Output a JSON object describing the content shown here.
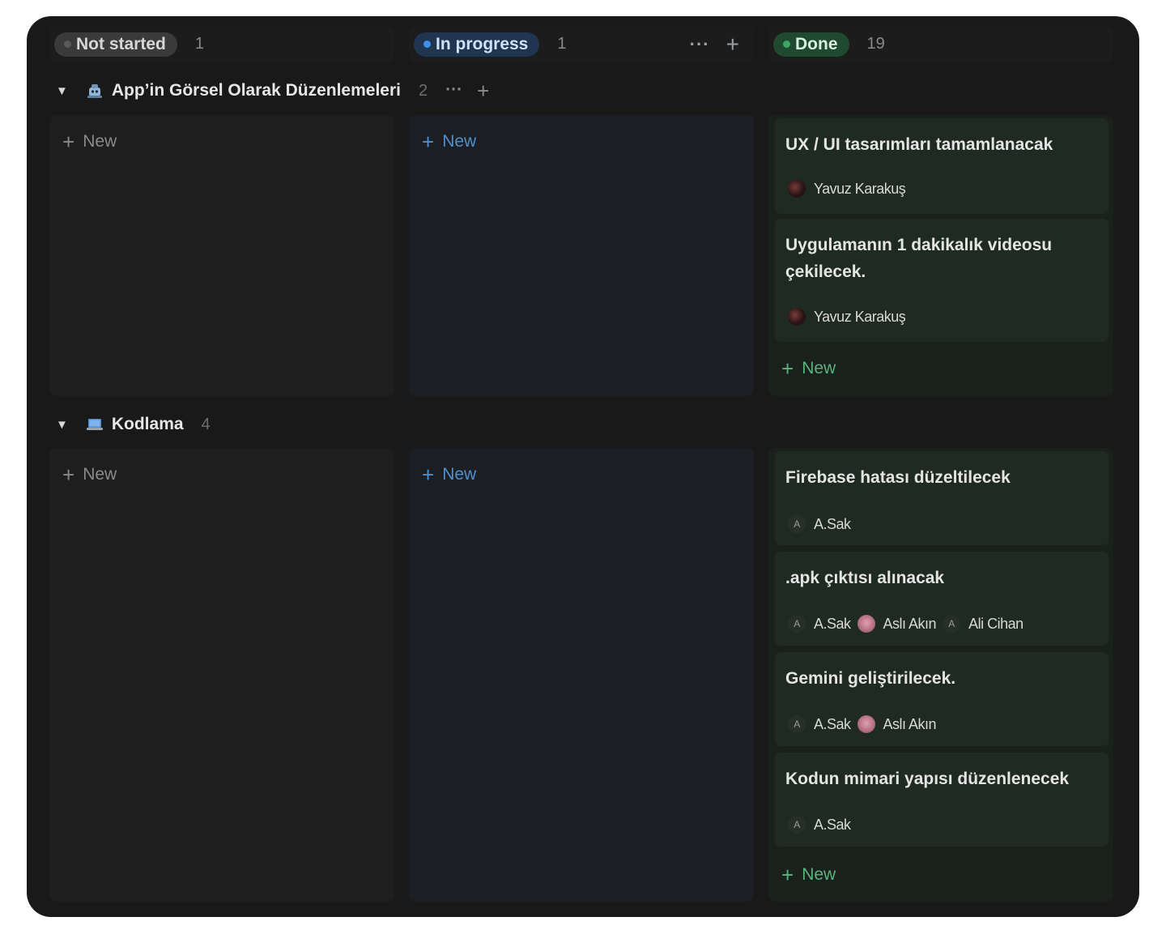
{
  "columns": [
    {
      "status": "Not started",
      "count": "1",
      "dot_color": "#5a5a5a",
      "pill_bg": "#3a3a3a",
      "pill_fg": "#d6d6d6"
    },
    {
      "status": "In progress",
      "count": "1",
      "dot_color": "#3f8ee8",
      "pill_bg": "#1f3550",
      "pill_fg": "#cfe3f7"
    },
    {
      "status": "Done",
      "count": "19",
      "dot_color": "#3fa565",
      "pill_bg": "#1f4a2f",
      "pill_fg": "#d6efdf"
    }
  ],
  "header_actions": {
    "more": "···",
    "add": "+"
  },
  "new_label": "New",
  "groups": [
    {
      "icon": "gear-bot-icon",
      "name": "App’in Görsel Olarak Düzenlemeleri",
      "count": "2",
      "more": "···",
      "add": "+",
      "done_cards": [
        {
          "title": "UX / UI tasarımları tamamlanacak",
          "people": [
            {
              "name": "Yavuz Karakuş",
              "avatar": "photo-dark"
            }
          ]
        },
        {
          "title": "Uygulamanın 1 dakikalık videosu çekilecek.",
          "people": [
            {
              "name": "Yavuz Karakuş",
              "avatar": "photo-dark"
            }
          ]
        }
      ]
    },
    {
      "icon": "laptop-icon",
      "name": "Kodlama",
      "count": "4",
      "done_cards": [
        {
          "title": "Firebase hatası düzeltilecek",
          "people": [
            {
              "name": "A.Sak",
              "avatar": "letter",
              "initial": "A"
            }
          ]
        },
        {
          "title": ".apk çıktısı alınacak",
          "people": [
            {
              "name": "A.Sak",
              "avatar": "letter",
              "initial": "A"
            },
            {
              "name": "Aslı Akın",
              "avatar": "photo-pink"
            },
            {
              "name": "Ali Cihan",
              "avatar": "letter",
              "initial": "A"
            }
          ]
        },
        {
          "title": "Gemini geliştirilecek.",
          "people": [
            {
              "name": "A.Sak",
              "avatar": "letter",
              "initial": "A"
            },
            {
              "name": "Aslı Akın",
              "avatar": "photo-pink"
            }
          ]
        },
        {
          "title": "Kodun mimari yapısı düzenlenecek",
          "people": [
            {
              "name": "A.Sak",
              "avatar": "letter",
              "initial": "A"
            }
          ]
        }
      ]
    }
  ]
}
